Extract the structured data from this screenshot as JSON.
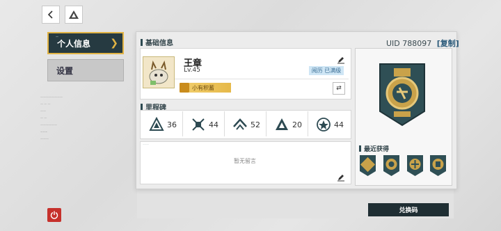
{
  "header": {
    "back_icon": "chevron-left-icon",
    "logo_icon": "triangle-logo-icon"
  },
  "sidebar": {
    "items": [
      {
        "label": "个人信息",
        "active": true
      },
      {
        "label": "设置",
        "active": false
      }
    ]
  },
  "profile": {
    "section_title": "基础信息",
    "uid_label": "UID",
    "uid_value": "788097",
    "copy_label": "[复制]",
    "name": "王章",
    "level": "Lv.45",
    "exp_badge": "阅历 已满级",
    "medal_tag": "小有积蓄"
  },
  "milestones": {
    "section_title": "里程碑",
    "items": [
      {
        "icon": "milestone-triangle-icon",
        "value": "36"
      },
      {
        "icon": "milestone-cross-icon",
        "value": "44"
      },
      {
        "icon": "milestone-chevron-icon",
        "value": "52"
      },
      {
        "icon": "milestone-pyramid-icon",
        "value": "20"
      },
      {
        "icon": "milestone-star-icon",
        "value": "44"
      }
    ]
  },
  "message": {
    "empty_text": "暂无留言"
  },
  "recent": {
    "section_title": "最近获得",
    "medals": [
      "medal-1-icon",
      "medal-2-icon",
      "medal-3-icon",
      "medal-4-icon"
    ]
  },
  "actions": {
    "redeem_label": "兑换码"
  },
  "colors": {
    "accent_gold": "#e1b344",
    "dark_teal": "#263a41",
    "danger": "#c6312c"
  }
}
